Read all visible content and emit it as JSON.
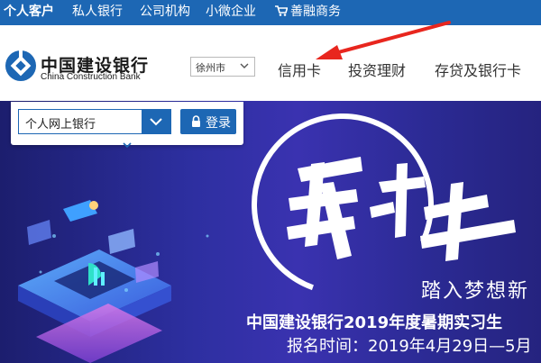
{
  "top_nav": {
    "items": [
      "个人客户",
      "私人银行",
      "公司机构",
      "小微企业",
      "善融商务"
    ]
  },
  "brand": {
    "name_cn": "中国建设银行",
    "name_en": "China Construction Bank"
  },
  "city_select": {
    "value": "徐州市"
  },
  "main_nav": {
    "items": [
      "信用卡",
      "投资理财",
      "存贷及银行卡"
    ]
  },
  "login": {
    "type_select": "个人网上银行",
    "button_label": "登录"
  },
  "banner": {
    "slogan": "踏入梦想新",
    "headline": "中国建设银行2019年度暑期实习生",
    "registration": "报名时间：2019年4月29日—5月"
  },
  "colors": {
    "brand_blue": "#1d67b4",
    "banner_bg": "#2d2fa0",
    "annotation_arrow": "#e8261e"
  }
}
